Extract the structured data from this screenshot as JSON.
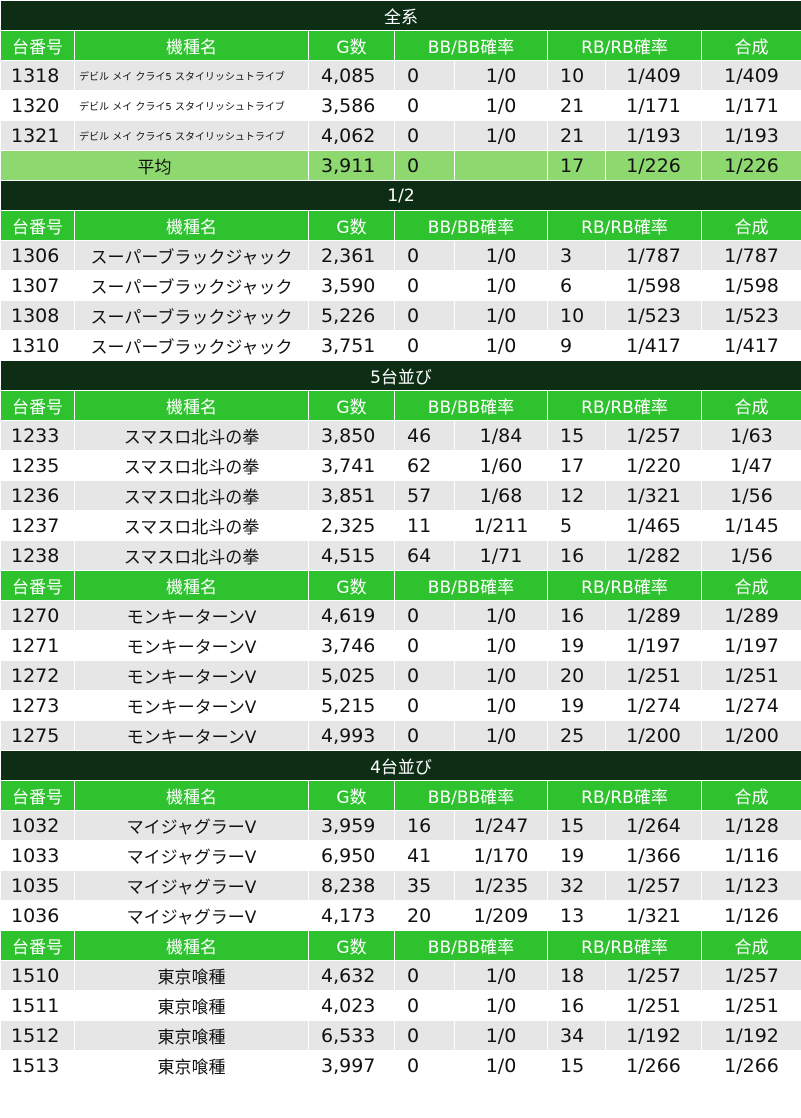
{
  "headers": {
    "machine_no": "台番号",
    "machine_name": "機種名",
    "games": "G数",
    "bb": "BB/BB確率",
    "rb": "RB/RB確率",
    "combined": "合成"
  },
  "blocks": [
    {
      "section": "全系",
      "show_header": true,
      "small_name": true,
      "rows": [
        {
          "no": "1318",
          "name": "デビル メイ クライ5 スタイリッシュトライブ",
          "g": "4,085",
          "bb": "0",
          "bb_rate": "1/0",
          "rb": "10",
          "rb_rate": "1/409",
          "total": "1/409"
        },
        {
          "no": "1320",
          "name": "デビル メイ クライ5 スタイリッシュトライブ",
          "g": "3,586",
          "bb": "0",
          "bb_rate": "1/0",
          "rb": "21",
          "rb_rate": "1/171",
          "total": "1/171"
        },
        {
          "no": "1321",
          "name": "デビル メイ クライ5 スタイリッシュトライブ",
          "g": "4,062",
          "bb": "0",
          "bb_rate": "1/0",
          "rb": "21",
          "rb_rate": "1/193",
          "total": "1/193"
        }
      ],
      "average": {
        "label": "平均",
        "g": "3,911",
        "bb": "0",
        "bb_rate": "",
        "rb": "17",
        "rb_rate": "1/226",
        "total": "1/226"
      }
    },
    {
      "section": "1/2",
      "show_header": true,
      "small_name": false,
      "rows": [
        {
          "no": "1306",
          "name": "スーパーブラックジャック",
          "g": "2,361",
          "bb": "0",
          "bb_rate": "1/0",
          "rb": "3",
          "rb_rate": "1/787",
          "total": "1/787"
        },
        {
          "no": "1307",
          "name": "スーパーブラックジャック",
          "g": "3,590",
          "bb": "0",
          "bb_rate": "1/0",
          "rb": "6",
          "rb_rate": "1/598",
          "total": "1/598"
        },
        {
          "no": "1308",
          "name": "スーパーブラックジャック",
          "g": "5,226",
          "bb": "0",
          "bb_rate": "1/0",
          "rb": "10",
          "rb_rate": "1/523",
          "total": "1/523"
        },
        {
          "no": "1310",
          "name": "スーパーブラックジャック",
          "g": "3,751",
          "bb": "0",
          "bb_rate": "1/0",
          "rb": "9",
          "rb_rate": "1/417",
          "total": "1/417"
        }
      ]
    },
    {
      "section": "5台並び",
      "show_header": true,
      "small_name": false,
      "rows": [
        {
          "no": "1233",
          "name": "スマスロ北斗の拳",
          "g": "3,850",
          "bb": "46",
          "bb_rate": "1/84",
          "rb": "15",
          "rb_rate": "1/257",
          "total": "1/63"
        },
        {
          "no": "1235",
          "name": "スマスロ北斗の拳",
          "g": "3,741",
          "bb": "62",
          "bb_rate": "1/60",
          "rb": "17",
          "rb_rate": "1/220",
          "total": "1/47"
        },
        {
          "no": "1236",
          "name": "スマスロ北斗の拳",
          "g": "3,851",
          "bb": "57",
          "bb_rate": "1/68",
          "rb": "12",
          "rb_rate": "1/321",
          "total": "1/56"
        },
        {
          "no": "1237",
          "name": "スマスロ北斗の拳",
          "g": "2,325",
          "bb": "11",
          "bb_rate": "1/211",
          "rb": "5",
          "rb_rate": "1/465",
          "total": "1/145"
        },
        {
          "no": "1238",
          "name": "スマスロ北斗の拳",
          "g": "4,515",
          "bb": "64",
          "bb_rate": "1/71",
          "rb": "16",
          "rb_rate": "1/282",
          "total": "1/56"
        }
      ]
    },
    {
      "section": "",
      "show_header": true,
      "small_name": false,
      "rows": [
        {
          "no": "1270",
          "name": "モンキーターンV",
          "g": "4,619",
          "bb": "0",
          "bb_rate": "1/0",
          "rb": "16",
          "rb_rate": "1/289",
          "total": "1/289"
        },
        {
          "no": "1271",
          "name": "モンキーターンV",
          "g": "3,746",
          "bb": "0",
          "bb_rate": "1/0",
          "rb": "19",
          "rb_rate": "1/197",
          "total": "1/197"
        },
        {
          "no": "1272",
          "name": "モンキーターンV",
          "g": "5,025",
          "bb": "0",
          "bb_rate": "1/0",
          "rb": "20",
          "rb_rate": "1/251",
          "total": "1/251"
        },
        {
          "no": "1273",
          "name": "モンキーターンV",
          "g": "5,215",
          "bb": "0",
          "bb_rate": "1/0",
          "rb": "19",
          "rb_rate": "1/274",
          "total": "1/274"
        },
        {
          "no": "1275",
          "name": "モンキーターンV",
          "g": "4,993",
          "bb": "0",
          "bb_rate": "1/0",
          "rb": "25",
          "rb_rate": "1/200",
          "total": "1/200"
        }
      ]
    },
    {
      "section": "4台並び",
      "show_header": true,
      "small_name": false,
      "rows": [
        {
          "no": "1032",
          "name": "マイジャグラーV",
          "g": "3,959",
          "bb": "16",
          "bb_rate": "1/247",
          "rb": "15",
          "rb_rate": "1/264",
          "total": "1/128"
        },
        {
          "no": "1033",
          "name": "マイジャグラーV",
          "g": "6,950",
          "bb": "41",
          "bb_rate": "1/170",
          "rb": "19",
          "rb_rate": "1/366",
          "total": "1/116"
        },
        {
          "no": "1035",
          "name": "マイジャグラーV",
          "g": "8,238",
          "bb": "35",
          "bb_rate": "1/235",
          "rb": "32",
          "rb_rate": "1/257",
          "total": "1/123"
        },
        {
          "no": "1036",
          "name": "マイジャグラーV",
          "g": "4,173",
          "bb": "20",
          "bb_rate": "1/209",
          "rb": "13",
          "rb_rate": "1/321",
          "total": "1/126"
        }
      ]
    },
    {
      "section": "",
      "show_header": true,
      "small_name": false,
      "rows": [
        {
          "no": "1510",
          "name": "東京喰種",
          "g": "4,632",
          "bb": "0",
          "bb_rate": "1/0",
          "rb": "18",
          "rb_rate": "1/257",
          "total": "1/257"
        },
        {
          "no": "1511",
          "name": "東京喰種",
          "g": "4,023",
          "bb": "0",
          "bb_rate": "1/0",
          "rb": "16",
          "rb_rate": "1/251",
          "total": "1/251"
        },
        {
          "no": "1512",
          "name": "東京喰種",
          "g": "6,533",
          "bb": "0",
          "bb_rate": "1/0",
          "rb": "34",
          "rb_rate": "1/192",
          "total": "1/192"
        },
        {
          "no": "1513",
          "name": "東京喰種",
          "g": "3,997",
          "bb": "0",
          "bb_rate": "1/0",
          "rb": "15",
          "rb_rate": "1/266",
          "total": "1/266"
        }
      ]
    }
  ]
}
